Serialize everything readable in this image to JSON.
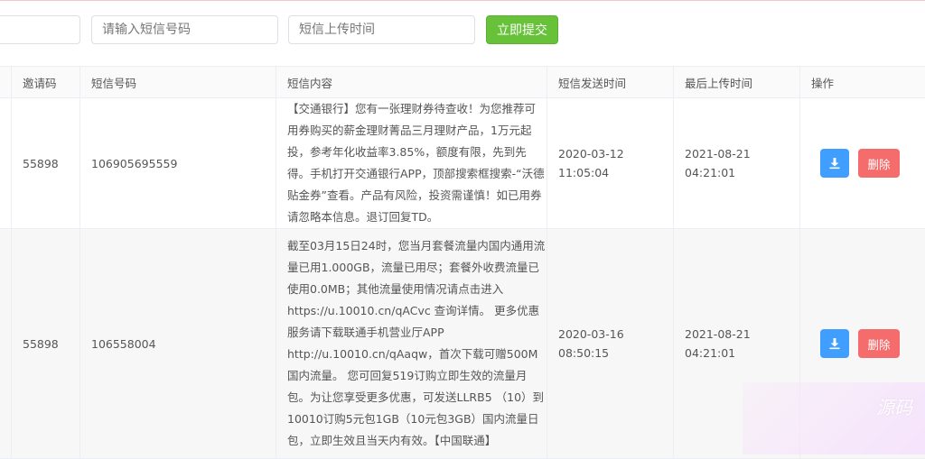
{
  "filters": {
    "first_placeholder": "",
    "phone_placeholder": "请输入短信号码",
    "time_placeholder": "短信上传时间",
    "submit_label": "立即提交"
  },
  "table": {
    "headers": {
      "invite": "邀请码",
      "phone": "短信号码",
      "content": "短信内容",
      "send_time": "短信发送时间",
      "upload_time": "最后上传时间",
      "actions": "操作"
    },
    "rows": [
      {
        "invite": "55898",
        "phone": "106905695559",
        "content": "【交通银行】您有一张理财券待查收！为您推荐可用券购买的薪金理财菁品三月理财产品，1万元起投，参考年化收益率3.85%，额度有限，先到先得。手机打开交通银行APP，顶部搜索框搜索-“沃德贴金券”查看。产品有风险，投资需谨慎！如已用券请忽略本信息。退订回复TD。",
        "send_date": "2020-03-12",
        "send_clock": "11:05:04",
        "upload_date": "2021-08-21",
        "upload_clock": "04:21:01",
        "delete_label": "删除"
      },
      {
        "invite": "55898",
        "phone": "106558004",
        "content": "截至03月15日24时，您当月套餐流量内国内通用流量已用1.000GB，流量已用尽；套餐外收费流量已使用0.0MB；其他流量使用情况请点击进入https://u.10010.cn/qACvc 查询详情。 更多优惠服务请下载联通手机营业厅APP http://u.10010.cn/qAaqw，首次下载可赠500M国内流量。 您可回复519订购立即生效的流量月包。为让您享受更多优惠，可发送LLRB5 （10）到10010订购5元包1GB（10元包3GB）国内流量日包，立即生效且当天内有效。【中国联通】",
        "send_date": "2020-03-16",
        "send_clock": "08:50:15",
        "upload_date": "2021-08-21",
        "upload_clock": "04:21:01",
        "delete_label": "删除"
      }
    ]
  },
  "icons": {
    "download": "download-icon"
  },
  "colors": {
    "primary": "#409eff",
    "success": "#67c23a",
    "danger": "#f56c6c"
  },
  "watermark_text": "源码"
}
